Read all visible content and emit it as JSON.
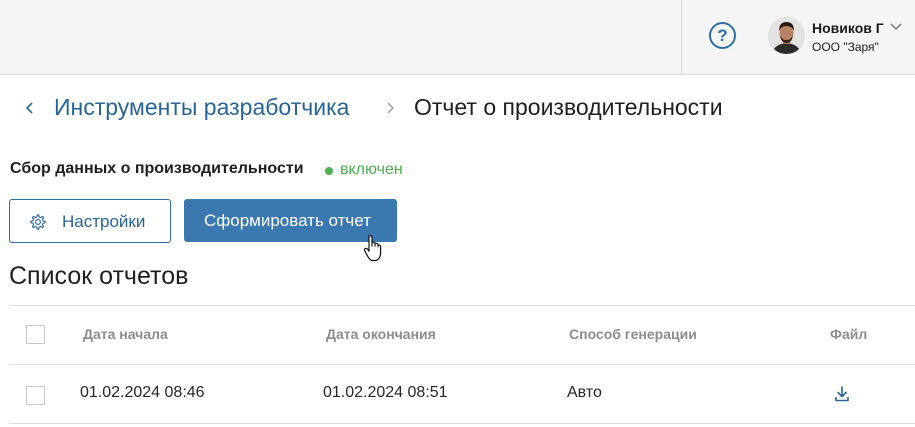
{
  "header": {
    "help_icon": "question-circle-icon",
    "help_glyph": "?",
    "user": {
      "name": "Новиков Г",
      "org": "ООО \"Заря\""
    }
  },
  "breadcrumb": {
    "back_icon": "chevron-left-icon",
    "parent": "Инструменты разработчика",
    "separator_icon": "chevron-right-icon",
    "current": "Отчет о производительности"
  },
  "collection": {
    "label": "Сбор данных о производительности",
    "status": "включен",
    "status_color": "#4caf50"
  },
  "actions": {
    "settings_label": "Настройки",
    "settings_icon": "gear-icon",
    "generate_label": "Сформировать отчет"
  },
  "reports": {
    "title": "Список отчетов",
    "columns": [
      "Дата начала",
      "Дата окончания",
      "Способ генерации",
      "Файл"
    ],
    "rows": [
      {
        "start": "01.02.2024 08:46",
        "end": "01.02.2024 08:51",
        "method": "Авто",
        "file_icon": "download-icon"
      }
    ]
  },
  "colors": {
    "accent": "#3b78b0",
    "link": "#2a6496",
    "topbar": "#f5f5f5"
  }
}
